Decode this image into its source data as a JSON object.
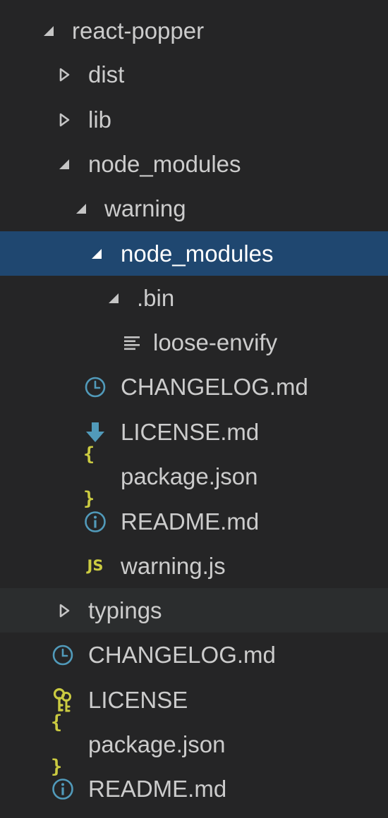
{
  "explorer": {
    "items": [
      {
        "label": "react-popper",
        "icon": "chevron-expanded"
      },
      {
        "label": "dist",
        "icon": "chevron-collapsed"
      },
      {
        "label": "lib",
        "icon": "chevron-collapsed"
      },
      {
        "label": "node_modules",
        "icon": "chevron-expanded"
      },
      {
        "label": "warning",
        "icon": "chevron-expanded"
      },
      {
        "label": "node_modules",
        "icon": "chevron-expanded",
        "selected": true
      },
      {
        "label": ".bin",
        "icon": "chevron-expanded"
      },
      {
        "label": "loose-envify",
        "icon": "lines-icon"
      },
      {
        "label": "CHANGELOG.md",
        "icon": "clock-icon"
      },
      {
        "label": "LICENSE.md",
        "icon": "download-arrow-icon"
      },
      {
        "label": "package.json",
        "icon": "braces-icon",
        "glyph": "{ }"
      },
      {
        "label": "README.md",
        "icon": "info-icon"
      },
      {
        "label": "warning.js",
        "icon": "js-icon",
        "glyph": "JS"
      },
      {
        "label": "typings",
        "icon": "chevron-collapsed"
      },
      {
        "label": "CHANGELOG.md",
        "icon": "clock-icon"
      },
      {
        "label": "LICENSE",
        "icon": "key-icon"
      },
      {
        "label": "package.json",
        "icon": "braces-icon",
        "glyph": "{ }"
      },
      {
        "label": "README.md",
        "icon": "info-icon"
      }
    ]
  },
  "colors": {
    "background": "#252526",
    "selected": "#1f4770",
    "hover": "#2b2d2e",
    "text": "#cccccc",
    "icon_blue": "#519aba",
    "icon_yellow": "#cbcb41"
  }
}
